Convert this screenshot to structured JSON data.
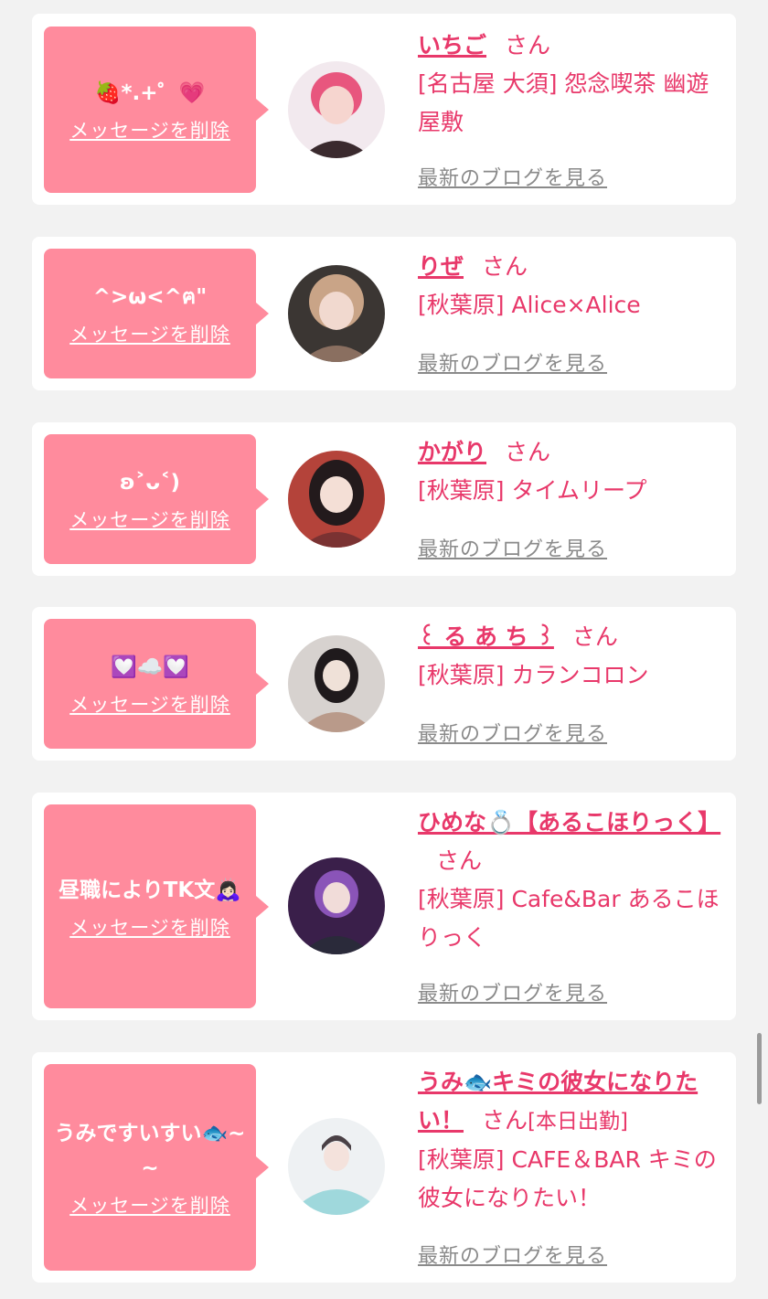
{
  "entries": [
    {
      "message": "🍓*.+゜💗",
      "delete_label": "メッセージを削除",
      "name": "いちご",
      "san": "さん",
      "extra": "",
      "shop": "[名古屋 大須] 怨念喫茶 幽遊屋敷",
      "blog_label": "最新のブログを見る",
      "avatar_colors": [
        "#f2e9ee",
        "#e8567e",
        "#f6d5cf",
        "#3a2a2e"
      ]
    },
    {
      "message": "^>ω<^ฅ\"",
      "delete_label": "メッセージを削除",
      "name": "りぜ",
      "san": "さん",
      "extra": "",
      "shop": "[秋葉原] Alice×Alice",
      "blog_label": "最新のブログを見る",
      "avatar_colors": [
        "#3b3633",
        "#c9a487",
        "#f1d9cf",
        "#8a6f60"
      ]
    },
    {
      "message": "ʚ˃ᴗ˂)",
      "delete_label": "メッセージを削除",
      "name": "かがり",
      "san": "さん",
      "extra": "",
      "shop": "[秋葉原] タイムリープ",
      "blog_label": "最新のブログを見る",
      "avatar_colors": [
        "#b4433a",
        "#231a1c",
        "#f4dfd6",
        "#7a3232"
      ]
    },
    {
      "message": "💟☁️💟",
      "delete_label": "メッセージを削除",
      "name": "꒰ る あ ち ꒱",
      "san": "さん",
      "extra": "",
      "shop": "[秋葉原] カランコロン",
      "blog_label": "最新のブログを見る",
      "avatar_colors": [
        "#d7d2cf",
        "#1f1a1c",
        "#efe1d8",
        "#b99a8a"
      ]
    },
    {
      "message": "昼職によりTK文🙇🏻‍♀️",
      "delete_label": "メッセージを削除",
      "name": "ひめな💍【あるこほりっく】",
      "san": "さん",
      "extra": "",
      "shop": "[秋葉原] Cafe&Bar あるこほりっく",
      "blog_label": "最新のブログを見る",
      "avatar_colors": [
        "#3a1f4a",
        "#8a54b8",
        "#f1dcd9",
        "#2a2a3a"
      ]
    },
    {
      "message": "うみですいすい🐟~~",
      "delete_label": "メッセージを削除",
      "name": "うみ🐟キミの彼女になりたい！",
      "san": "さん",
      "extra": "[本日出勤]",
      "shop": "[秋葉原] CAFE＆BAR キミの彼女になりたい！",
      "blog_label": "最新のブログを見る",
      "avatar_colors": [
        "#eef1f3",
        "#9fd8dc",
        "#f4e2dc",
        "#4a4045"
      ]
    }
  ],
  "colors": {
    "accent": "#e8386a",
    "bubble": "#ff8b9d",
    "background": "#f2f2f2",
    "link_gray": "#8a8a8a"
  }
}
